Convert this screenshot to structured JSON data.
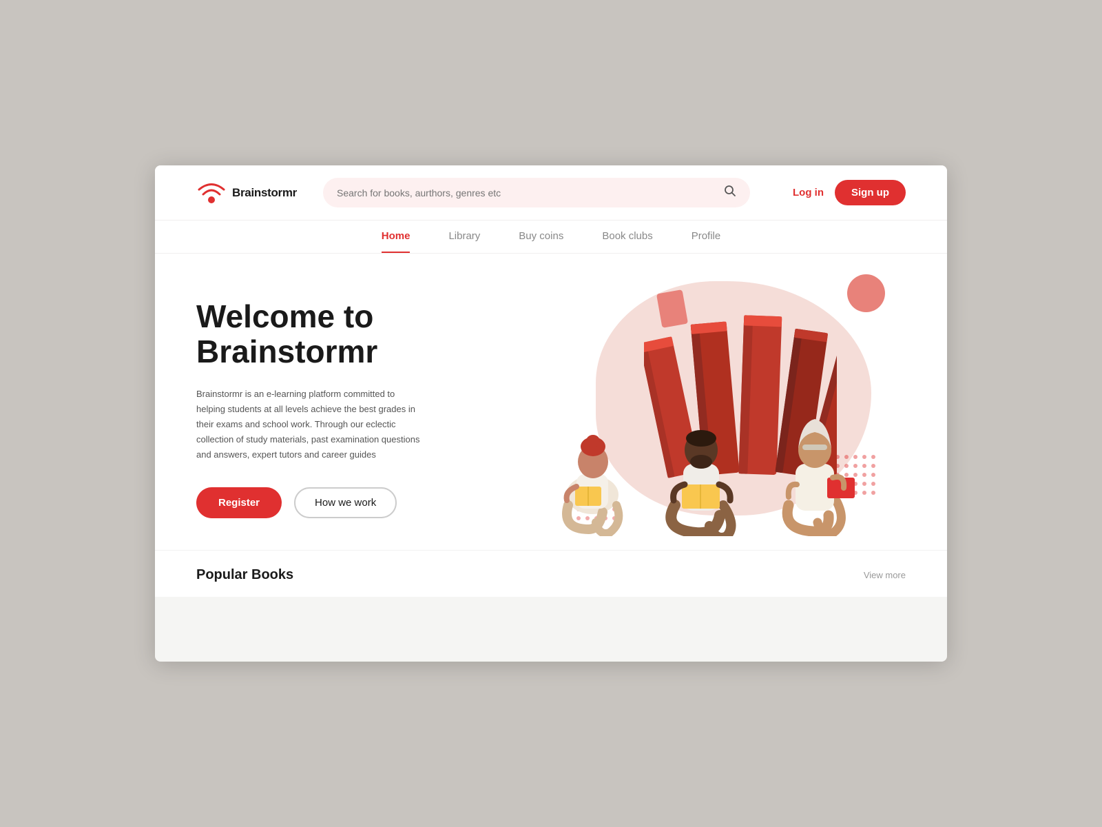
{
  "brand": {
    "name": "Brainstormr"
  },
  "header": {
    "search_placeholder": "Search for books, aurthors, genres etc",
    "login_label": "Log in",
    "signup_label": "Sign up"
  },
  "nav": {
    "items": [
      {
        "label": "Home",
        "active": true
      },
      {
        "label": "Library",
        "active": false
      },
      {
        "label": "Buy coins",
        "active": false
      },
      {
        "label": "Book clubs",
        "active": false
      },
      {
        "label": "Profile",
        "active": false
      }
    ]
  },
  "hero": {
    "title": "Welcome to Brainstormr",
    "description": "Brainstormr is an e-learning platform committed to helping students at all levels achieve the best grades in their exams and school work. Through our eclectic collection of study materials, past examination questions and answers, expert tutors and career guides",
    "register_label": "Register",
    "how_we_work_label": "How we work"
  },
  "popular_books": {
    "section_title": "Popular Books",
    "view_more_label": "View more"
  },
  "colors": {
    "accent": "#e03030",
    "blob_main": "#f5ddd8",
    "blob_accent": "#e8827a"
  }
}
